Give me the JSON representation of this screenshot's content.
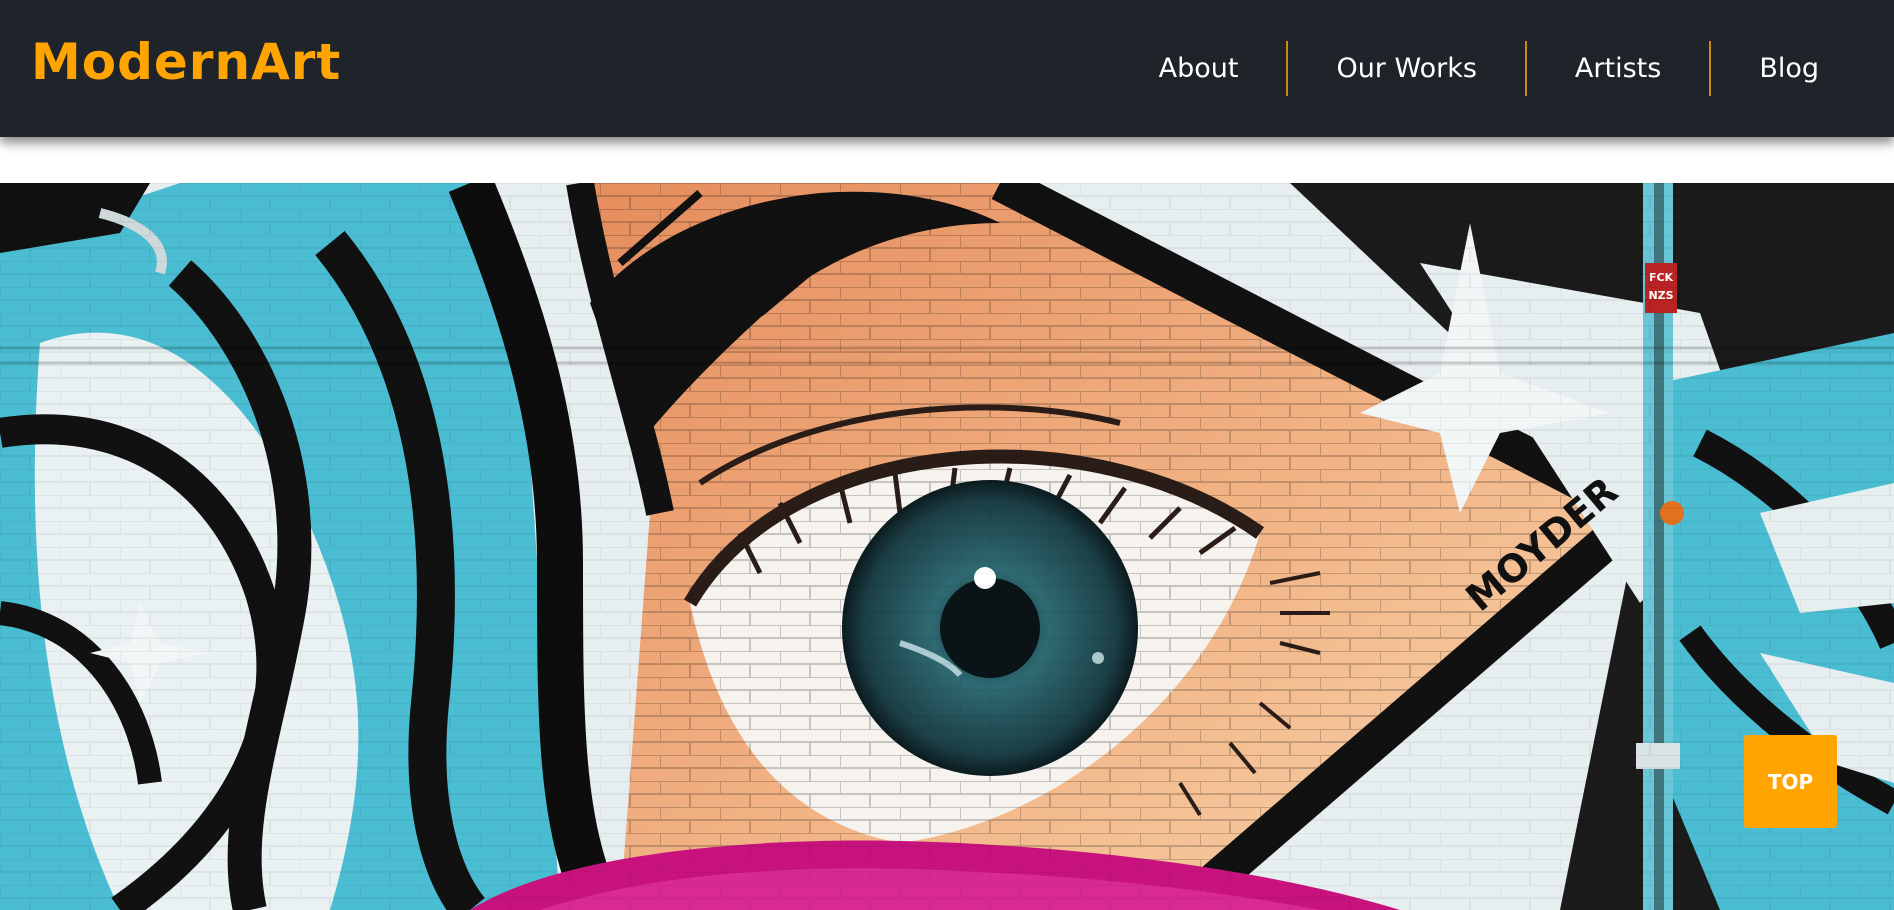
{
  "brand": {
    "name": "ModernArt"
  },
  "nav": {
    "items": [
      {
        "label": "About"
      },
      {
        "label": "Our Works"
      },
      {
        "label": "Artists"
      },
      {
        "label": "Blog"
      }
    ]
  },
  "hero": {
    "image": "graffiti-eye-mural",
    "mural_tags": {
      "signature": "MOYDER",
      "sticker_line1": "FCK",
      "sticker_line2": "NZS"
    }
  },
  "top_button": {
    "label": "TOP"
  },
  "colors": {
    "navbar_bg": "#1f242b",
    "accent": "#ffa400",
    "nav_text": "#ffffff",
    "separator": "#c98b15"
  },
  "icons": {
    "scroll_top": "top-button"
  }
}
